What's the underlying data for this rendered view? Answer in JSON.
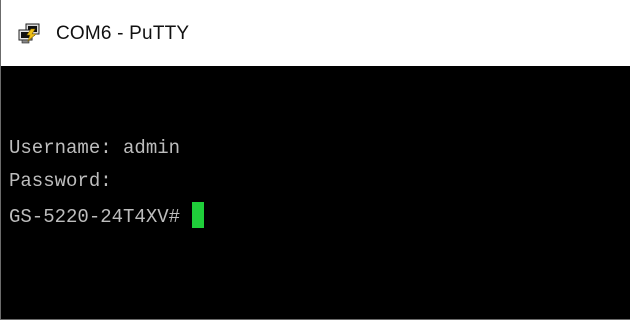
{
  "window": {
    "title": "COM6 - PuTTY",
    "app_icon": "putty-terminal-icon"
  },
  "terminal": {
    "lines": [
      "Username: admin",
      "Password:",
      "GS-5220-24T4XV#"
    ],
    "cursor_color": "#1fcf3a",
    "text_color": "#bdbdbd",
    "background_color": "#000000"
  }
}
